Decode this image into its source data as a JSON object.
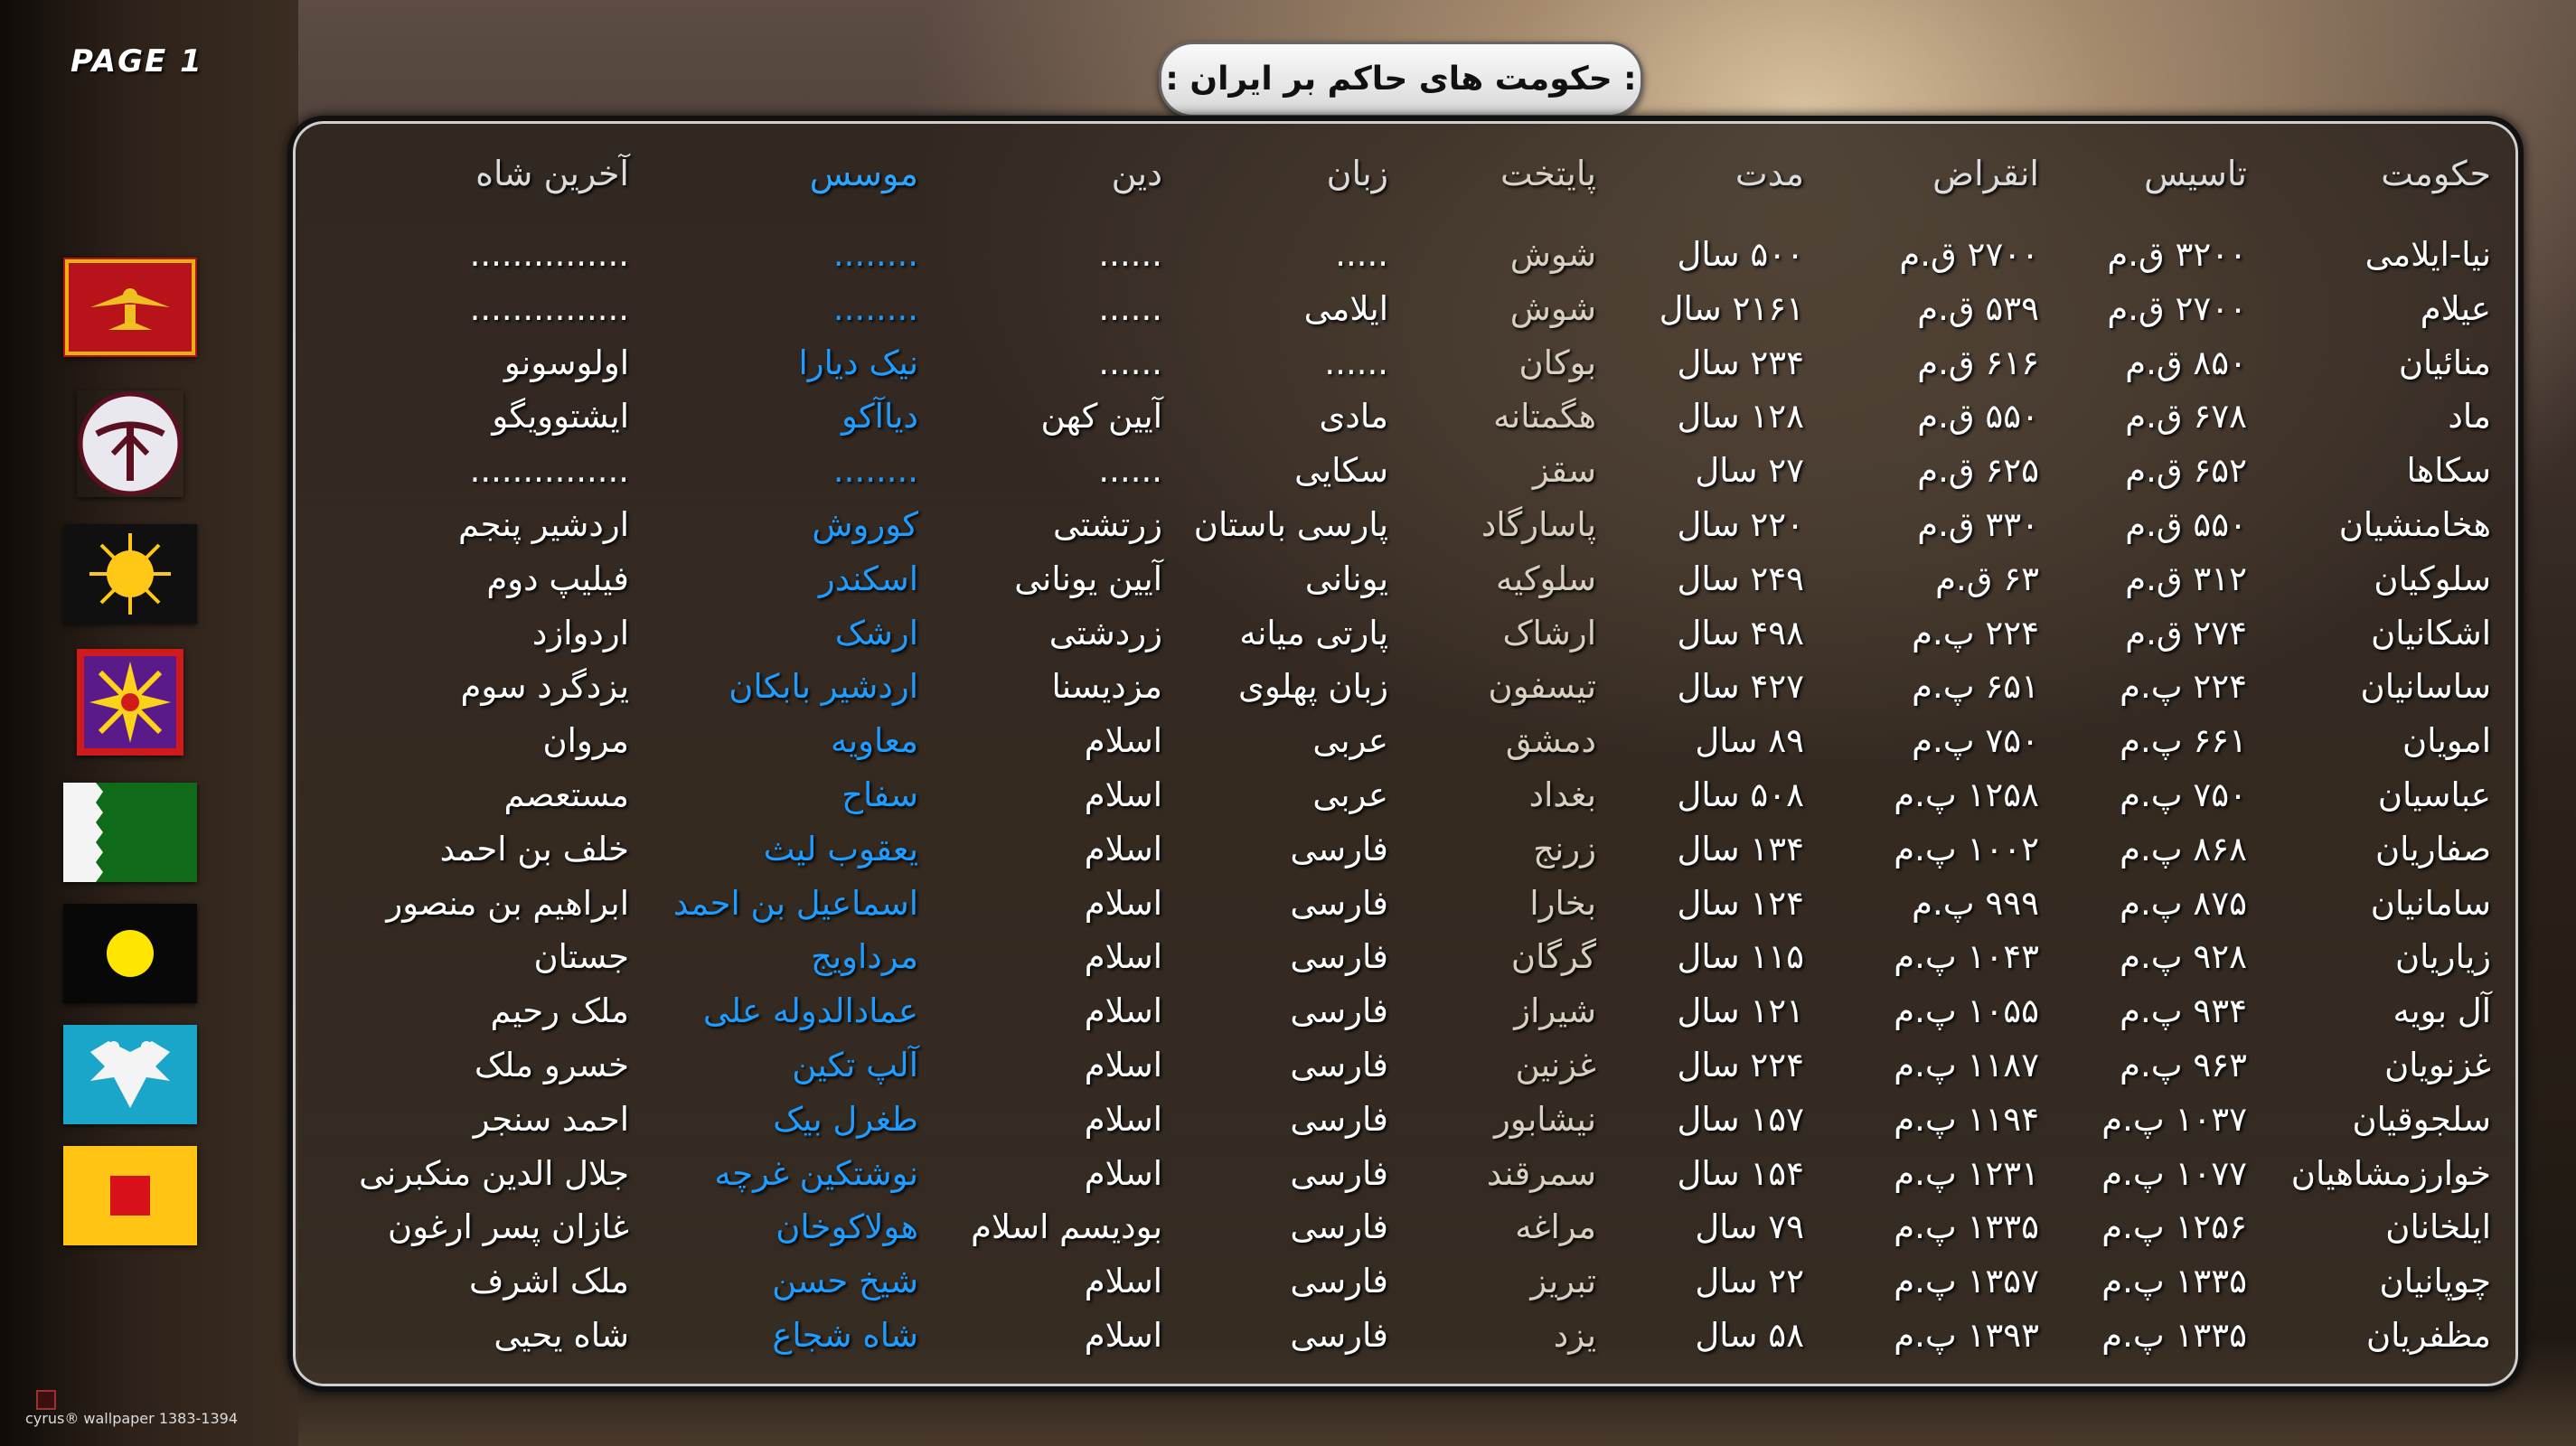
{
  "page_label": "PAGE 1",
  "title": ": حکومت های حاکم بر ایران :",
  "credit": "cyrus® wallpaper 1383-1394",
  "headers": [
    "حکومت",
    "تاسیس",
    "انقراض",
    "مدت",
    "پایتخت",
    "زبان",
    "دین",
    "موسس",
    "آخرین شاه"
  ],
  "rows": [
    [
      "نیا-ایلامی",
      "۳۲۰۰ ق.م",
      "۲۷۰۰ ق.م",
      "۵۰۰ سال",
      "شوش",
      ".....",
      "......",
      "........",
      "..............."
    ],
    [
      "عیلام",
      "۲۷۰۰ ق.م",
      "۵۳۹ ق.م",
      "۲۱۶۱ سال",
      "شوش",
      "ایلامی",
      "......",
      "........",
      "..............."
    ],
    [
      "منائیان",
      "۸۵۰ ق.م",
      "۶۱۶ ق.م",
      "۲۳۴ سال",
      "بوکان",
      "......",
      "......",
      "نیک دیارا",
      "اولوسونو"
    ],
    [
      "ماد",
      "۶۷۸ ق.م",
      "۵۵۰ ق.م",
      "۱۲۸ سال",
      "هگمتانه",
      "مادی",
      "آیین کهن",
      "دیاآکو",
      "ایشتوویگو"
    ],
    [
      "سکاها",
      "۶۵۲ ق.م",
      "۶۲۵ ق.م",
      "۲۷ سال",
      "سقز",
      "سکایی",
      "......",
      "........",
      "..............."
    ],
    [
      "هخامنشیان",
      "۵۵۰ ق.م",
      "۳۳۰ ق.م",
      "۲۲۰ سال",
      "پاسارگاد",
      "پارسی باستان",
      "زرتشتی",
      "کوروش",
      "اردشیر پنجم"
    ],
    [
      "سلوکیان",
      "۳۱۲ ق.م",
      "۶۳ ق.م",
      "۲۴۹ سال",
      "سلوکیه",
      "یونانی",
      "آیین یونانی",
      "اسکندر",
      "فیلیپ دوم"
    ],
    [
      "اشکانیان",
      "۲۷۴ ق.م",
      "۲۲۴ پ.م",
      "۴۹۸ سال",
      "ارشاک",
      "پارتی میانه",
      "زردشتی",
      "ارشک",
      "اردوازد"
    ],
    [
      "ساسانیان",
      "۲۲۴ پ.م",
      "۶۵۱ پ.م",
      "۴۲۷ سال",
      "تیسفون",
      "زبان پهلوی",
      "مزدیسنا",
      "اردشیر بابکان",
      "یزدگرد سوم"
    ],
    [
      "امویان",
      "۶۶۱ پ.م",
      "۷۵۰ پ.م",
      "۸۹ سال",
      "دمشق",
      "عربی",
      "اسلام",
      "معاویه",
      "مروان"
    ],
    [
      "عباسیان",
      "۷۵۰ پ.م",
      "۱۲۵۸ پ.م",
      "۵۰۸ سال",
      "بغداد",
      "عربی",
      "اسلام",
      "سفاح",
      "مستعصم"
    ],
    [
      "صفاریان",
      "۸۶۸ پ.م",
      "۱۰۰۲ پ.م",
      "۱۳۴ سال",
      "زرنج",
      "فارسی",
      "اسلام",
      "یعقوب لیث",
      "خلف بن احمد"
    ],
    [
      "سامانیان",
      "۸۷۵ پ.م",
      "۹۹۹ پ.م",
      "۱۲۴ سال",
      "بخارا",
      "فارسی",
      "اسلام",
      "اسماعیل بن احمد",
      "ابراهیم بن منصور"
    ],
    [
      "زیاریان",
      "۹۲۸ پ.م",
      "۱۰۴۳ پ.م",
      "۱۱۵ سال",
      "گرگان",
      "فارسی",
      "اسلام",
      "مرداویج",
      "جستان"
    ],
    [
      "آل بویه",
      "۹۳۴ پ.م",
      "۱۰۵۵ پ.م",
      "۱۲۱ سال",
      "شیراز",
      "فارسی",
      "اسلام",
      "عمادالدوله علی",
      "ملک رحیم"
    ],
    [
      "غزنویان",
      "۹۶۳ پ.م",
      "۱۱۸۷ پ.م",
      "۲۲۴ سال",
      "غزنین",
      "فارسی",
      "اسلام",
      "آلپ تکین",
      "خسرو ملک"
    ],
    [
      "سلجوقیان",
      "۱۰۳۷ پ.م",
      "۱۱۹۴ پ.م",
      "۱۵۷ سال",
      "نیشابور",
      "فارسی",
      "اسلام",
      "طغرل بیک",
      "احمد سنجر"
    ],
    [
      "خوارزمشاهیان",
      "۱۰۷۷ پ.م",
      "۱۲۳۱ پ.م",
      "۱۵۴ سال",
      "سمرقند",
      "فارسی",
      "اسلام",
      "نوشتکین غرچه",
      "جلال الدین منکبرنی"
    ],
    [
      "ایلخانان",
      "۱۲۵۶ پ.م",
      "۱۳۳۵ پ.م",
      "۷۹ سال",
      "مراغه",
      "فارسی",
      "بودیسم اسلام",
      "هولاکوخان",
      "غازان پسر ارغون"
    ],
    [
      "چوپانیان",
      "۱۳۳۵ پ.م",
      "۱۳۵۷ پ.م",
      "۲۲ سال",
      "تبریز",
      "فارسی",
      "اسلام",
      "شیخ حسن",
      "ملک اشرف"
    ],
    [
      "مظفریان",
      "۱۳۳۵ پ.م",
      "۱۳۹۳ پ.م",
      "۵۸ سال",
      "یزد",
      "فارسی",
      "اسلام",
      "شاه شجاع",
      "شاه یحیی"
    ]
  ],
  "flags": [
    "faravahar-flag-icon",
    "medes-emblem-icon",
    "sun-flag-icon",
    "sasanian-star-flag-icon",
    "green-white-flag-icon",
    "black-yellow-disc-flag-icon",
    "double-eagle-flag-icon",
    "yellow-red-square-flag-icon"
  ],
  "colors": {
    "founder": "#1e9cff",
    "text": "#ffffff",
    "panel_border": "#111111"
  }
}
